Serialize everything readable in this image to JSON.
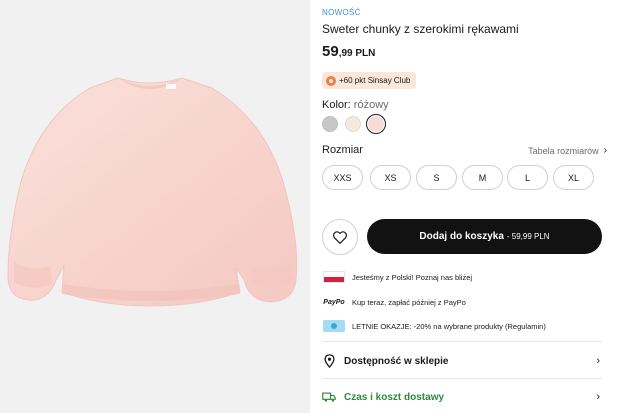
{
  "product": {
    "badge": "NOWOŚĆ",
    "title": "Sweter chunky z szerokimi rękawami",
    "price_int": "59",
    "price_dec": ",99",
    "currency": " PLN"
  },
  "club": {
    "text": "+60 pkt Sinsay Club"
  },
  "color": {
    "label": "Kolor: ",
    "value": "różowy",
    "swatches": [
      {
        "name": "gray",
        "hex": "#c7c7c7"
      },
      {
        "name": "cream",
        "hex": "#f3ebe0"
      },
      {
        "name": "pink",
        "hex": "#f6dcd6"
      }
    ]
  },
  "size": {
    "label": "Rozmiar",
    "guide": "Tabela rozmiarów",
    "options": [
      "XXS",
      "XS",
      "S",
      "M",
      "L",
      "XL"
    ]
  },
  "cart": {
    "label": "Dodaj do koszyka",
    "price": "- 59,99 PLN"
  },
  "promos": [
    {
      "icon": "poland-flag-icon",
      "text": "Jesteśmy z Polski! Poznaj nas bliżej"
    },
    {
      "icon": "paypo-logo",
      "logo_text": "PayPo",
      "text": "Kup teraz, zapłać później z PayPo"
    },
    {
      "icon": "ticket-icon",
      "text": "LETNIE OKAZJE: -20% na wybrane produkty (Regulamin)"
    }
  ],
  "accordions": [
    {
      "label": "Dostępność w sklepie",
      "icon": "location-pin-icon"
    },
    {
      "label": "Czas i koszt dostawy",
      "icon": "delivery-truck-icon"
    }
  ],
  "colors": {
    "accent_blue": "#3e8fd8",
    "button_black": "#121212",
    "delivery_green": "#2d8a3e",
    "sweater_pink": "#f8d6d0"
  }
}
